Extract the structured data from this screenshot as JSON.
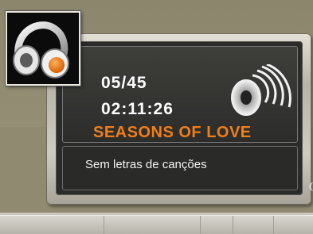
{
  "player": {
    "track_counter": "05/45",
    "elapsed_time": "02:11:26",
    "track_title": "SEASONS OF LOVE",
    "lyrics_message": "Sem letras de canções"
  },
  "icons": {
    "app_icon": "headphones-icon",
    "volume_icon": "speaker-icon"
  },
  "colors": {
    "title_accent": "#f07e1a",
    "panel_bg": "#2b2b29",
    "text_primary": "#ffffff"
  }
}
